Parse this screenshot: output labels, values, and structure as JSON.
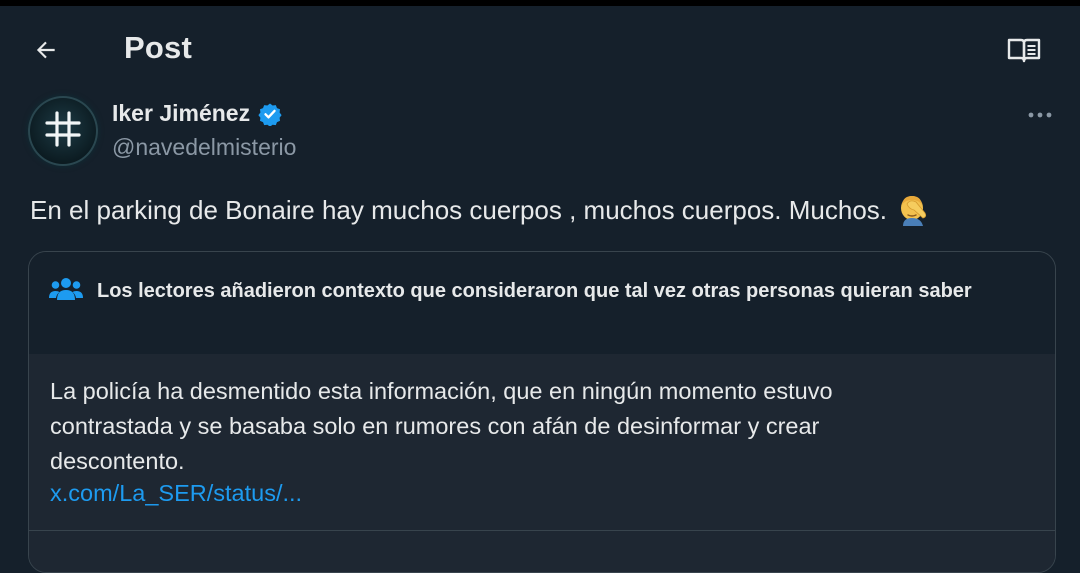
{
  "header": {
    "title": "Post",
    "back_icon": "arrow-left-icon",
    "reader_icon": "reader-mode-icon"
  },
  "author": {
    "name": "Iker Jiménez",
    "handle": "@navedelmisterio",
    "verified": true,
    "avatar_icon": "hashtag-logo-avatar"
  },
  "tweet": {
    "text": "En el parking de Bonaire hay muchos cuerpos , muchos cuerpos. Muchos.",
    "emoji": "facepalm-emoji"
  },
  "community_note": {
    "title": "Los lectores añadieron contexto que consideraron que tal vez otras personas quieran saber",
    "body": "La policía ha desmentido esta información, que en ningún momento estuvo contrastada y se basaba solo en rumores con afán de desinformar y crear descontento.",
    "link": "x.com/La_SER/status/..."
  },
  "colors": {
    "background": "#15202b",
    "note_body_bg": "#1e2732",
    "text": "#e7e9ea",
    "secondary_text": "#8b98a5",
    "link": "#1d9bf0",
    "verified_badge": "#1d9bf0",
    "border": "#38444d"
  }
}
